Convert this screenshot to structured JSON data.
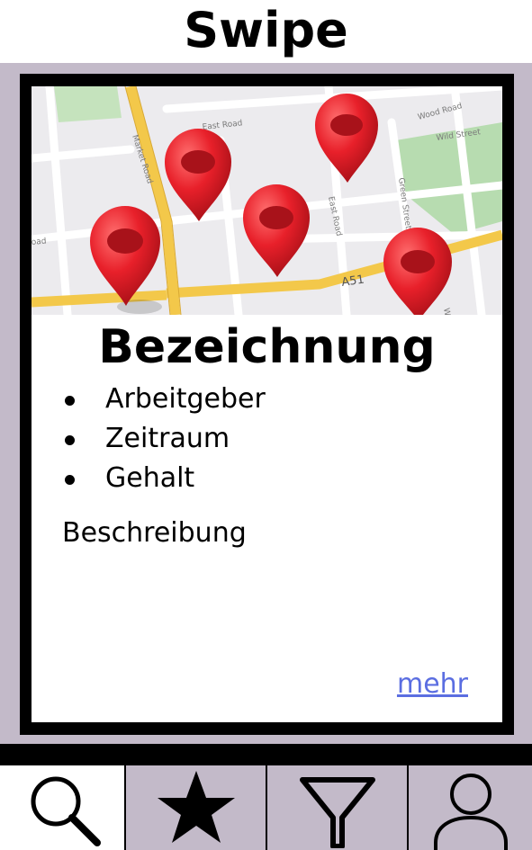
{
  "header": {
    "title": "Swipe"
  },
  "card": {
    "title": "Bezeichnung",
    "details": [
      "Arbeitgeber",
      "Zeitraum",
      "Gehalt"
    ],
    "description": "Beschreibung",
    "more_label": "mehr",
    "image": {
      "street_labels": [
        "Market Road",
        "East Road",
        "East Road",
        "Wood Road",
        "Wild Street",
        "Green Street",
        "A51",
        "oad",
        "We"
      ]
    }
  },
  "tabbar": {
    "tabs": [
      {
        "name": "search",
        "icon": "search-icon",
        "active": true
      },
      {
        "name": "favorites",
        "icon": "star-icon",
        "active": false
      },
      {
        "name": "filter",
        "icon": "filter-icon",
        "active": false
      },
      {
        "name": "profile",
        "icon": "user-icon",
        "active": false
      }
    ]
  },
  "colors": {
    "background": "#c3bac9",
    "frame": "#000000",
    "card": "#ffffff",
    "link": "#5b6ee1",
    "pin": "#e8202a",
    "road_yellow": "#f3c84a",
    "park_green": "#b7dcb0"
  }
}
